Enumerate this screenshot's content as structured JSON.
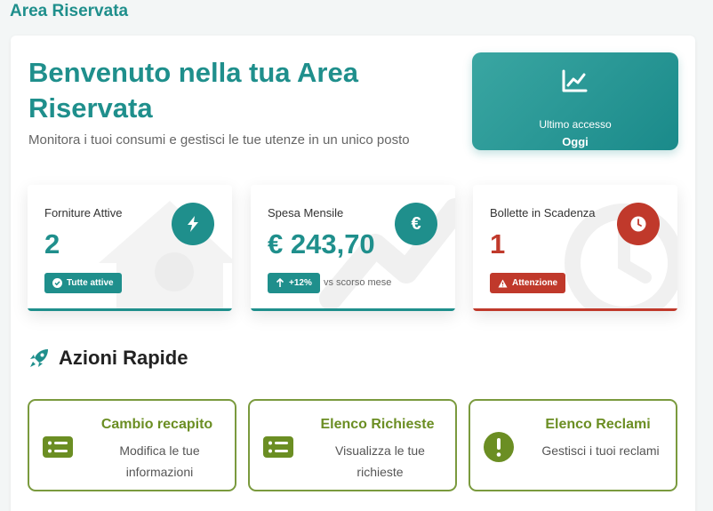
{
  "app": {
    "title": "Area Riservata"
  },
  "welcome": {
    "title": "Benvenuto nella tua Area Riservata",
    "subtitle": "Monitora i tuoi consumi e gestisci le tue utenze in un unico posto"
  },
  "last_access": {
    "label": "Ultimo accesso",
    "value": "Oggi",
    "icon": "line-chart-icon"
  },
  "stats": [
    {
      "label": "Forniture Attive",
      "value": "2",
      "icon": "bolt-icon",
      "badge": "Tutte attive",
      "badge_icon": "check-circle-icon",
      "color": "#1f8f8c",
      "badge_color": "#1f8f8c"
    },
    {
      "label": "Spesa Mensile",
      "value": "€ 243,70",
      "icon": "euro-icon",
      "badge": "+12%",
      "badge_icon": "arrow-up-icon",
      "note": "vs scorso mese",
      "color": "#1f8f8c",
      "badge_color": "#1f8f8c"
    },
    {
      "label": "Bollette in Scadenza",
      "value": "1",
      "icon": "clock-icon",
      "badge": "Attenzione",
      "badge_icon": "warning-icon",
      "color": "#c0392b",
      "badge_color": "#c0392b"
    }
  ],
  "quick_actions": {
    "title": "Azioni Rapide",
    "icon": "rocket-icon",
    "items": [
      {
        "title": "Cambio recapito",
        "desc": "Modifica le tue informazioni",
        "icon": "list-icon"
      },
      {
        "title": "Elenco Richieste",
        "desc": "Visualizza le tue richieste",
        "icon": "list-icon"
      },
      {
        "title": "Elenco Reclami",
        "desc": "Gestisci i tuoi reclami",
        "icon": "exclamation-circle-icon"
      }
    ]
  },
  "colors": {
    "primary": "#1f8f8c",
    "danger": "#c0392b",
    "accent_green": "#6b8e23"
  }
}
